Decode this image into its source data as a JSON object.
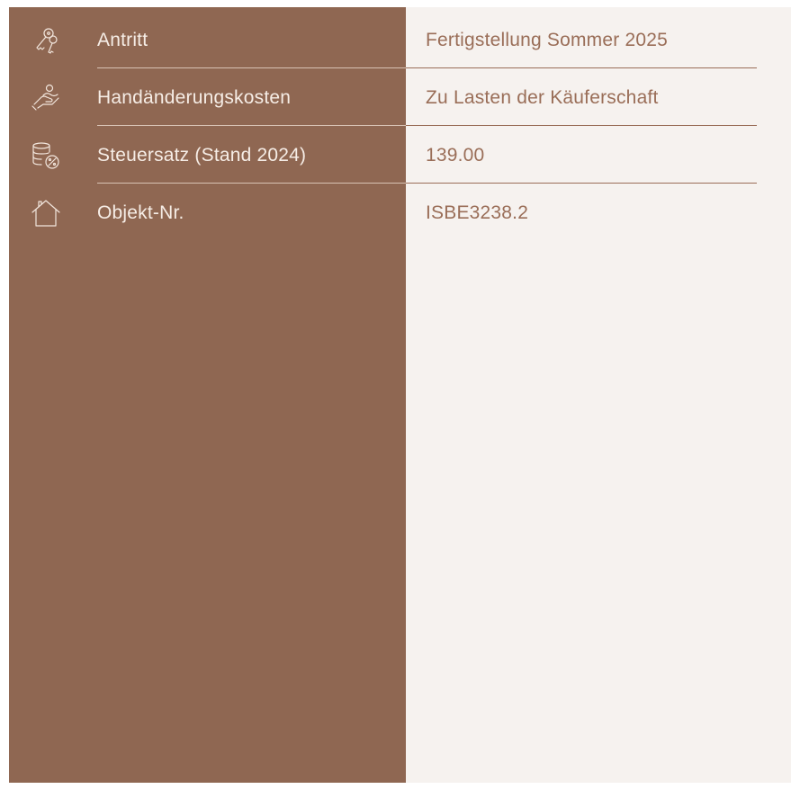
{
  "colors": {
    "left_panel": "#8f6752",
    "right_panel": "#f6f2ef",
    "label_text": "#f6ede6",
    "value_text": "#9a6e58"
  },
  "rows": [
    {
      "icon": "keys-icon",
      "label": "Antritt",
      "value": "Fertigstellung Sommer 2025"
    },
    {
      "icon": "hand-coin-icon",
      "label": "Handänderungskosten",
      "value": "Zu Lasten der Käuferschaft"
    },
    {
      "icon": "database-percent-icon",
      "label": "Steuersatz (Stand 2024)",
      "value": "139.00"
    },
    {
      "icon": "house-icon",
      "label": "Objekt-Nr.",
      "value": "ISBE3238.2"
    }
  ]
}
